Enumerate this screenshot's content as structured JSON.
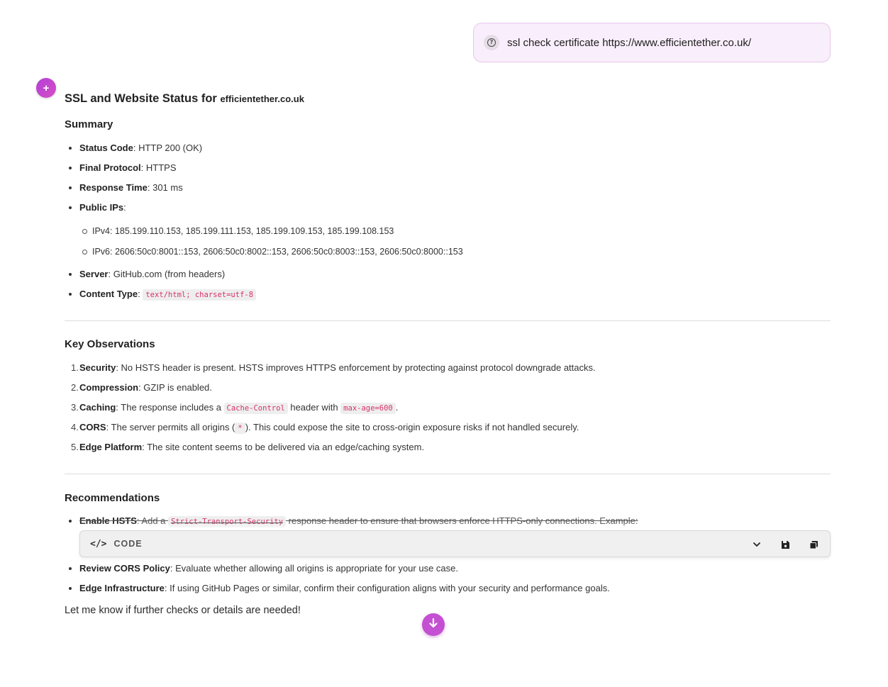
{
  "query": {
    "text": "ssl check certificate https://www.efficientether.co.uk/",
    "icon": "question-circle-icon"
  },
  "assistant": {
    "avatar_glyph": "+",
    "title_prefix": "SSL and Website Status for",
    "title_domain": "efficientether.co.uk",
    "summary": {
      "heading": "Summary",
      "status_label": "Status Code",
      "status_value": ": HTTP 200 (OK)",
      "protocol_label": "Final Protocol",
      "protocol_value": ": HTTPS",
      "response_label": "Response Time",
      "response_value": ": 301 ms",
      "ips_label": "Public IPs",
      "ips_colon": ":",
      "ipv4": "IPv4: 185.199.110.153, 185.199.111.153, 185.199.109.153, 185.199.108.153",
      "ipv6": "IPv6: 2606:50c0:8001::153, 2606:50c0:8002::153, 2606:50c0:8003::153, 2606:50c0:8000::153",
      "server_label": "Server",
      "server_value": ": GitHub.com (from headers)",
      "ctype_label": "Content Type",
      "ctype_colon": ": ",
      "ctype_code": "text/html; charset=utf-8"
    },
    "observations": {
      "heading": "Key Observations",
      "items": [
        {
          "n": "1.",
          "label": "Security",
          "text": ": No HSTS header is present. HSTS improves HTTPS enforcement by protecting against protocol downgrade attacks."
        },
        {
          "n": "2.",
          "label": "Compression",
          "text": ": GZIP is enabled."
        },
        {
          "n": "3.",
          "label": "Caching",
          "pre": ": The response includes a ",
          "code1": "Cache-Control",
          "mid": " header with ",
          "code2": "max-age=600",
          "post": "."
        },
        {
          "n": "4.",
          "label": "CORS",
          "pre": ": The server permits all origins (",
          "code1": "*",
          "post": "). This could expose the site to cross-origin exposure risks if not handled securely."
        },
        {
          "n": "5.",
          "label": "Edge Platform",
          "text": ": The site content seems to be delivered via an edge/caching system."
        }
      ]
    },
    "recommendations": {
      "heading": "Recommendations",
      "hsts_label": "Enable HSTS",
      "hsts_pre": ": Add a ",
      "hsts_code": "Strict-Transport-Security",
      "hsts_post": " response header to ensure that browsers enforce HTTPS-only connections. Example:",
      "code_block_label": "CODE",
      "cors_label": "Review CORS Policy",
      "cors_text": ": Evaluate whether allowing all origins is appropriate for your use case.",
      "edge_label": "Edge Infrastructure",
      "edge_text": ": If using GitHub Pages or similar, confirm their configuration aligns with your security and performance goals."
    },
    "closing": "Let me know if further checks or details are needed!"
  },
  "icons": {
    "code": "code-brackets-icon",
    "expand": "chevron-down-icon",
    "save": "floppy-save-icon",
    "copy": "copy-icon",
    "scroll": "arrow-down-icon"
  },
  "colors": {
    "accent": "#c44fd3",
    "query_bg": "#f9eefb",
    "code_text": "#d6336c"
  }
}
